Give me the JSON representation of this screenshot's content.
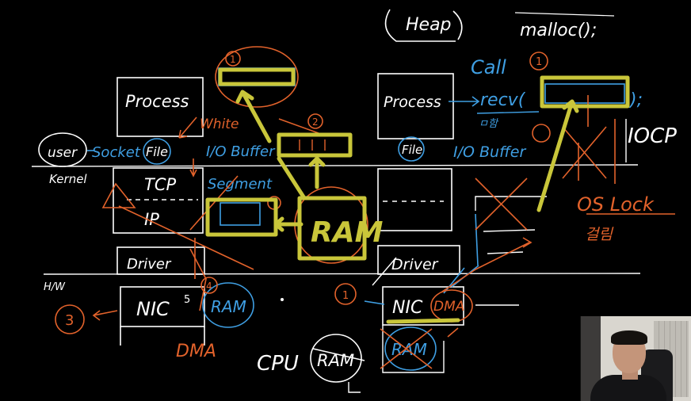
{
  "labels": {
    "heap": "Heap",
    "malloc": "malloc();",
    "call": "Call",
    "recv": "recv(",
    "recv_close": ");",
    "recv_sub": "ㅁ함",
    "iocp": "IOCP",
    "os_lock": "OS Lock",
    "os_lock_sub": "걸림",
    "white": "White",
    "user": "user",
    "kernel": "Kernel",
    "socket": "Socket",
    "file": "File",
    "io_buffer_left": "I/O Buffer",
    "io_buffer_right": "I/O Buffer",
    "process_left": "Process",
    "process_right": "Process",
    "tcp": "TCP",
    "ip": "IP",
    "segment": "Segment",
    "ram_big": "RAM",
    "driver_left": "Driver",
    "driver_right": "Driver",
    "hw": "H/W",
    "nic_left": "NIC",
    "nic_right": "NIC",
    "ram_left_nic": "RAM",
    "dma_left": "DMA",
    "dma_right": "DMA",
    "cpu": "CPU",
    "ram_cpu": "RAM",
    "ram_crossed": "RAM",
    "num_1": "1",
    "num_2": "2",
    "num_3": "3",
    "num_4": "4",
    "num_5": "5"
  },
  "colors": {
    "white": "#ffffff",
    "blue": "#3f9fe3",
    "orange": "#e2622b",
    "yellow": "#c9c63a",
    "grey": "#bbbbbb"
  }
}
